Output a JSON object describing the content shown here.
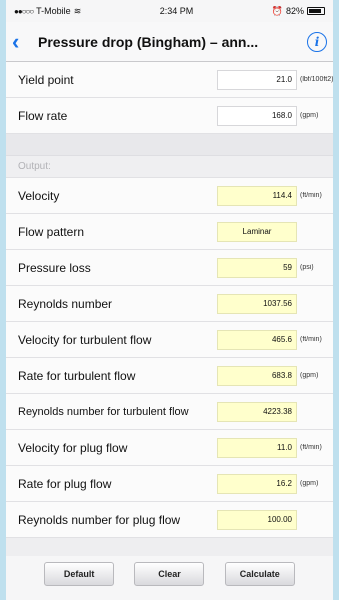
{
  "status_bar": {
    "carrier": "T-Mobile",
    "time": "2:34 PM",
    "battery": "82%"
  },
  "nav": {
    "title": "Pressure drop (Bingham) – ann...",
    "back_icon": "chevron-left-icon",
    "info_icon": "info-icon"
  },
  "inputs": [
    {
      "label": "Yield point",
      "value": "21.0",
      "unit": "(lbf/100ft2)"
    },
    {
      "label": "Flow rate",
      "value": "168.0",
      "unit": "(gpm)"
    }
  ],
  "output_header": "Output:",
  "outputs": [
    {
      "label": "Velocity",
      "value": "114.4",
      "unit": "(ft/min)"
    },
    {
      "label": "Flow pattern",
      "value": "Laminar",
      "unit": ""
    },
    {
      "label": "Pressure loss",
      "value": "59",
      "unit": "(psi)"
    },
    {
      "label": "Reynolds number",
      "value": "1037.56",
      "unit": ""
    },
    {
      "label": "Velocity for turbulent flow",
      "value": "465.6",
      "unit": "(ft/min)"
    },
    {
      "label": "Rate for turbulent flow",
      "value": "683.8",
      "unit": "(gpm)"
    },
    {
      "label": "Reynolds number for turbulent flow",
      "value": "4223.38",
      "unit": ""
    },
    {
      "label": "Velocity for plug flow",
      "value": "11.0",
      "unit": "(ft/min)"
    },
    {
      "label": "Rate for plug flow",
      "value": "16.2",
      "unit": "(gpm)"
    },
    {
      "label": "Reynolds number for plug flow",
      "value": "100.00",
      "unit": ""
    }
  ],
  "buttons": {
    "default": "Default",
    "clear": "Clear",
    "calculate": "Calculate"
  }
}
